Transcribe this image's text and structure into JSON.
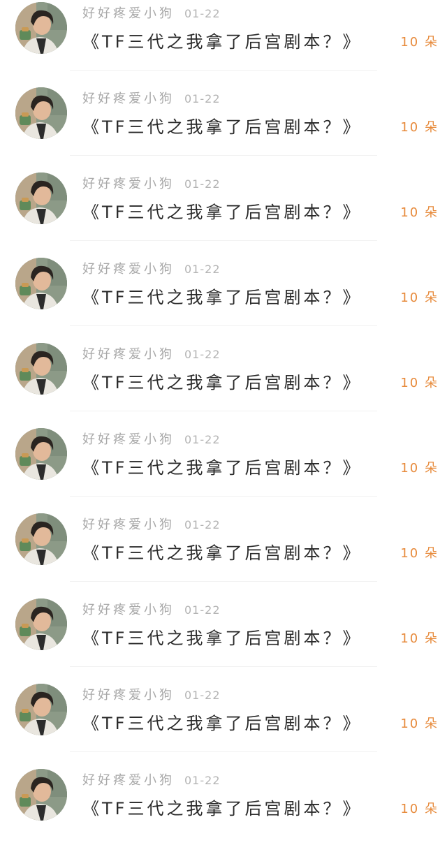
{
  "accent_color": "#e78a3b",
  "items": [
    {
      "author": "好好疼爱小狗",
      "date": "01-22",
      "title": "《TF三代之我拿了后宫剧本？》",
      "count": "10 朵"
    },
    {
      "author": "好好疼爱小狗",
      "date": "01-22",
      "title": "《TF三代之我拿了后宫剧本？》",
      "count": "10 朵"
    },
    {
      "author": "好好疼爱小狗",
      "date": "01-22",
      "title": "《TF三代之我拿了后宫剧本？》",
      "count": "10 朵"
    },
    {
      "author": "好好疼爱小狗",
      "date": "01-22",
      "title": "《TF三代之我拿了后宫剧本？》",
      "count": "10 朵"
    },
    {
      "author": "好好疼爱小狗",
      "date": "01-22",
      "title": "《TF三代之我拿了后宫剧本？》",
      "count": "10 朵"
    },
    {
      "author": "好好疼爱小狗",
      "date": "01-22",
      "title": "《TF三代之我拿了后宫剧本？》",
      "count": "10 朵"
    },
    {
      "author": "好好疼爱小狗",
      "date": "01-22",
      "title": "《TF三代之我拿了后宫剧本？》",
      "count": "10 朵"
    },
    {
      "author": "好好疼爱小狗",
      "date": "01-22",
      "title": "《TF三代之我拿了后宫剧本？》",
      "count": "10 朵"
    },
    {
      "author": "好好疼爱小狗",
      "date": "01-22",
      "title": "《TF三代之我拿了后宫剧本？》",
      "count": "10 朵"
    },
    {
      "author": "好好疼爱小狗",
      "date": "01-22",
      "title": "《TF三代之我拿了后宫剧本？》",
      "count": "10 朵"
    }
  ]
}
